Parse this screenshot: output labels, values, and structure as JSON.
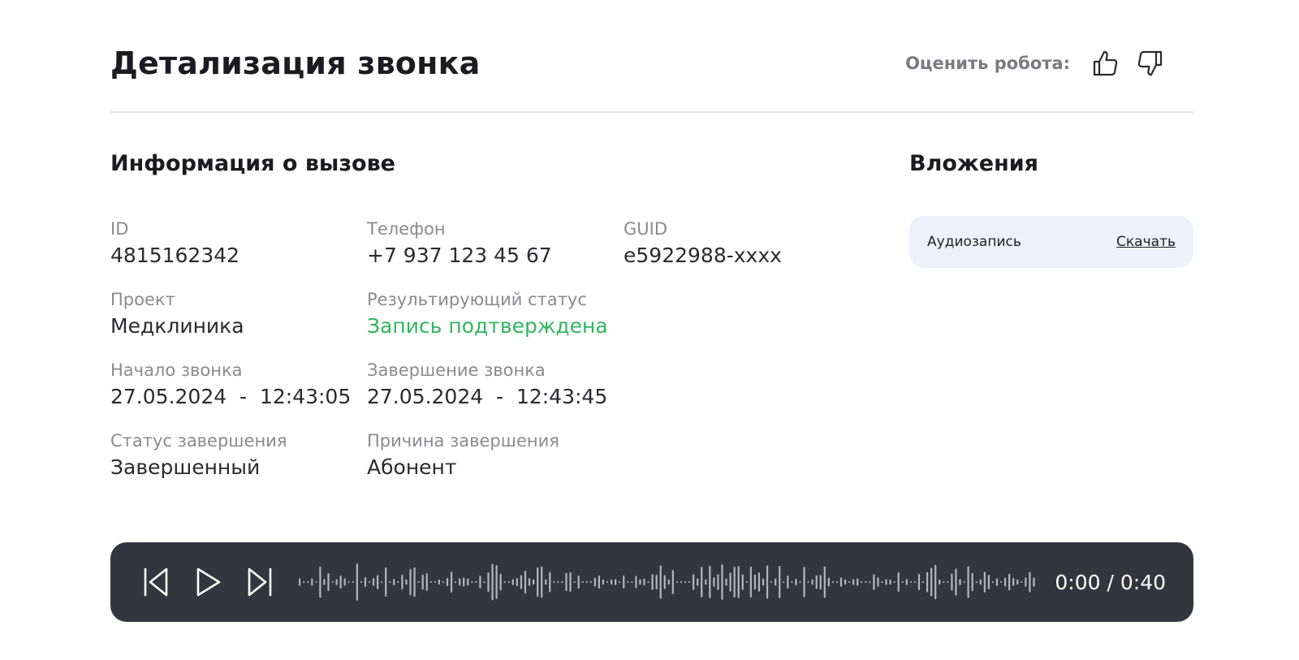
{
  "header": {
    "title": "Детализация звонка",
    "rate_label": "Оценить робота:",
    "like_icon": "thumbs-up-icon",
    "dislike_icon": "thumbs-down-icon"
  },
  "info": {
    "title": "Информация о вызове",
    "fields": [
      {
        "label": "ID",
        "value": "4815162342"
      },
      {
        "label": "Телефон",
        "value": "+7 937 123 45 67"
      },
      {
        "label": "GUID",
        "value": "e5922988-xxxx"
      },
      {
        "label": "Проект",
        "value": "Медклиника"
      },
      {
        "label": "Результирующий статус",
        "value": "Запись подтверждена",
        "color": "#2fb65f"
      },
      {
        "label": "",
        "value": ""
      },
      {
        "label": "Начало звонка",
        "value": "27.05.2024  -  12:43:05"
      },
      {
        "label": "Завершение звонка",
        "value": "27.05.2024  -  12:43:45"
      },
      {
        "label": "",
        "value": ""
      },
      {
        "label": "Статус завершения",
        "value": "Завершенный"
      },
      {
        "label": "Причина завершения",
        "value": "Абонент"
      }
    ]
  },
  "attachments": {
    "title": "Вложения",
    "items": [
      {
        "name": "Аудиозапись",
        "action": "Скачать"
      }
    ]
  },
  "player": {
    "controls": [
      "skip-back-icon",
      "play-icon",
      "skip-forward-icon"
    ],
    "current_time": "0:00",
    "separator": " / ",
    "duration": "0:40",
    "background": "#35353f",
    "progress": 0
  }
}
